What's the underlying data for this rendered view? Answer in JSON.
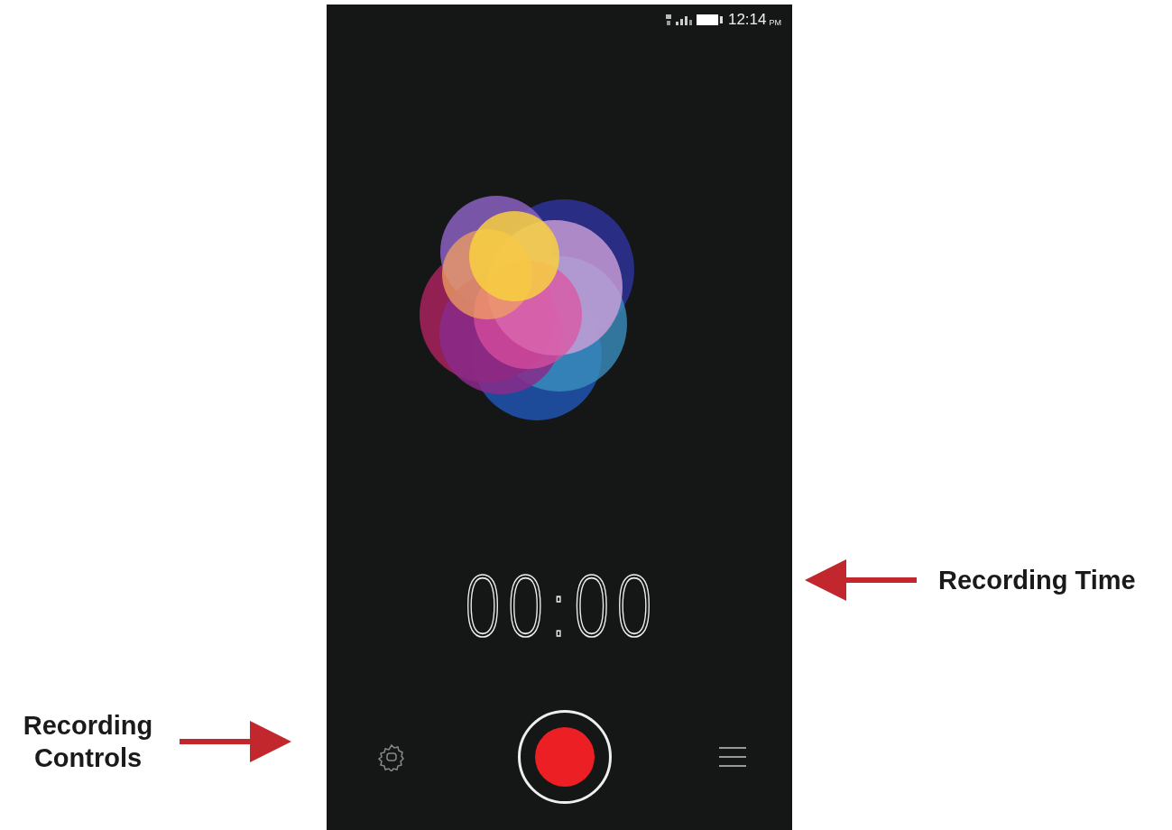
{
  "status_bar": {
    "time": "12:14",
    "period": "PM"
  },
  "recorder": {
    "timer": "00:00"
  },
  "callouts": [
    {
      "kind": "right",
      "text": "Recording Time"
    },
    {
      "kind": "left",
      "text": "Recording Controls"
    }
  ]
}
